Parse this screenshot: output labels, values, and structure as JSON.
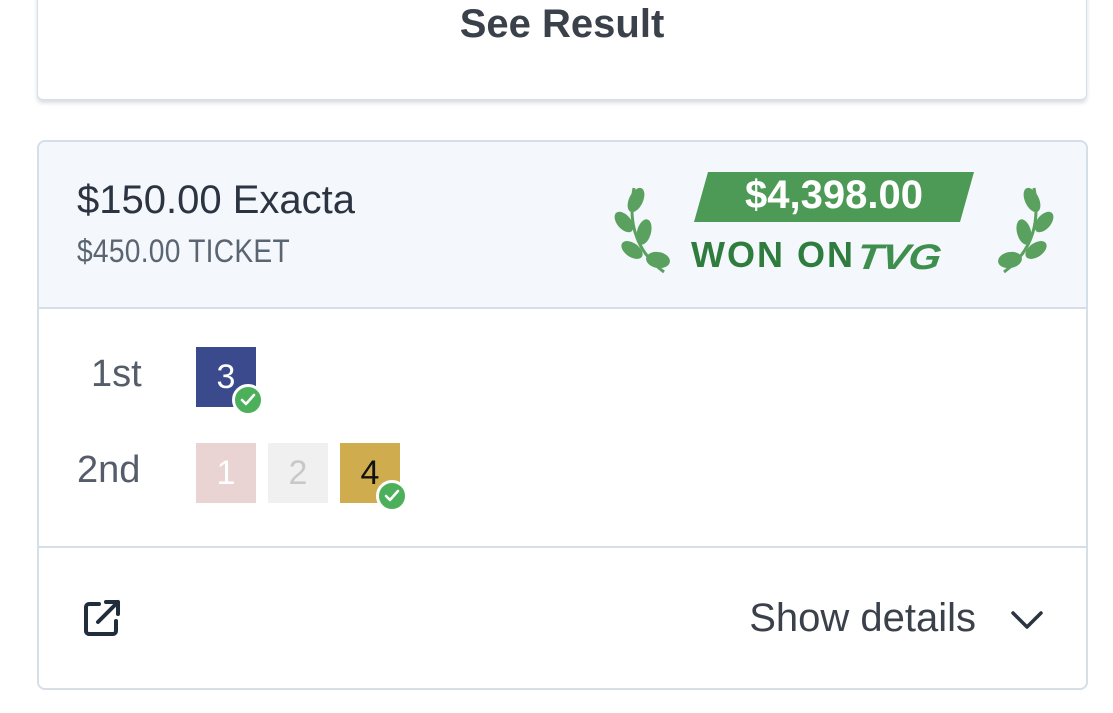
{
  "top_card": {
    "see_result_label": "See Result"
  },
  "bet": {
    "title": "$150.00 Exacta",
    "ticket": "$450.00 TICKET",
    "win": {
      "amount": "$4,398.00",
      "won_on_label": "WON ON",
      "brand": "TVG"
    },
    "finishes": [
      {
        "position": "1st",
        "runners": [
          {
            "number": "3",
            "selected": true,
            "bg": "#3b4a8c",
            "fg": "#ffffff"
          }
        ]
      },
      {
        "position": "2nd",
        "runners": [
          {
            "number": "1",
            "selected": false,
            "bg": "#ead3d3",
            "fg": "#ffffff"
          },
          {
            "number": "2",
            "selected": false,
            "bg": "#f0f0f0",
            "fg": "#c8c8c8"
          },
          {
            "number": "4",
            "selected": true,
            "bg": "#cfad4e",
            "fg": "#111111"
          }
        ]
      }
    ],
    "footer": {
      "external_link_icon": "external-link-icon",
      "show_details_label": "Show details",
      "chevron_icon": "chevron-down-icon"
    }
  },
  "colors": {
    "accent_green": "#4c9a55",
    "check_green": "#4caf5a",
    "border": "#d6dee8",
    "header_bg": "#f4f7fb"
  }
}
